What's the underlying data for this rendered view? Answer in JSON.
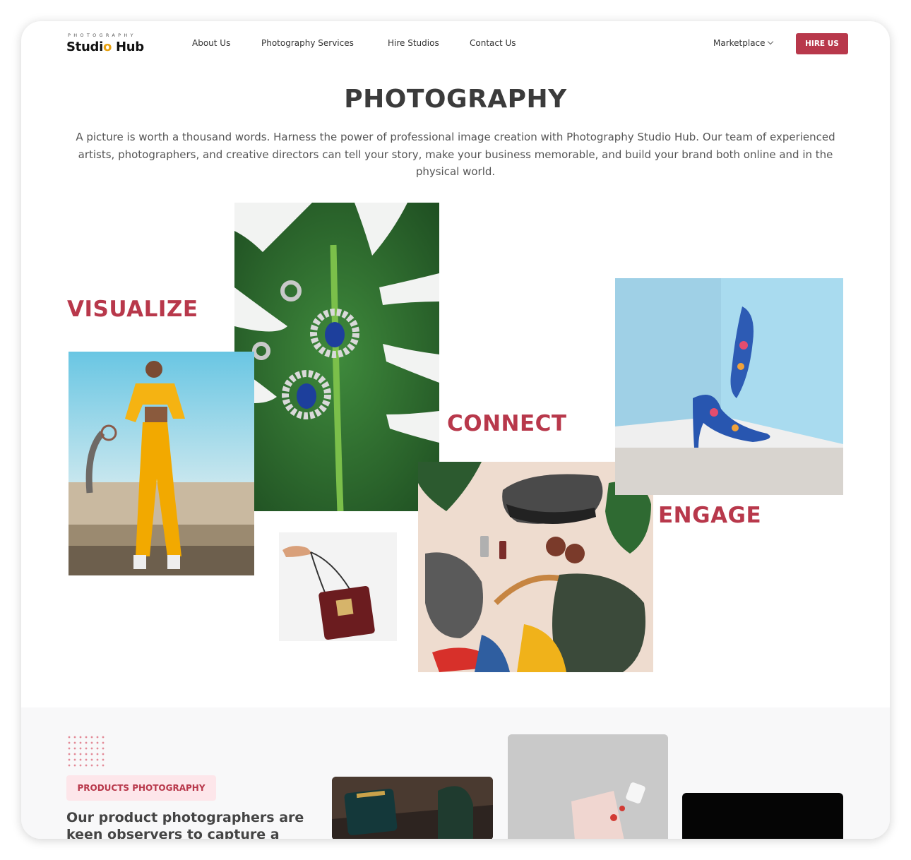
{
  "brand": {
    "tagline": "PHOTOGRAPHY",
    "name_part1": "Studi",
    "name_o": "o",
    "name_part2": " Hub"
  },
  "nav": {
    "links": [
      "About Us",
      "Photography Services",
      "Hire Studios",
      "Contact Us"
    ],
    "marketplace": "Marketplace",
    "cta": "HIRE US"
  },
  "hero": {
    "title": "PHOTOGRAPHY",
    "intro": "A picture is worth a thousand words. Harness the power of professional image creation with Photography Studio Hub. Our team of experienced artists, photographers, and creative directors can tell your story, make your business memorable, and build your brand both online and in the physical world."
  },
  "collage": {
    "words": [
      "VISUALIZE",
      "CONNECT",
      "ENGAGE"
    ]
  },
  "products": {
    "badge": "PRODUCTS PHOTOGRAPHY",
    "copy": "Our product photographers are keen observers to capture a range"
  },
  "colors": {
    "accent": "#b8384b",
    "badge_bg": "#fde6ea",
    "leaf": "#2f6b2f"
  }
}
